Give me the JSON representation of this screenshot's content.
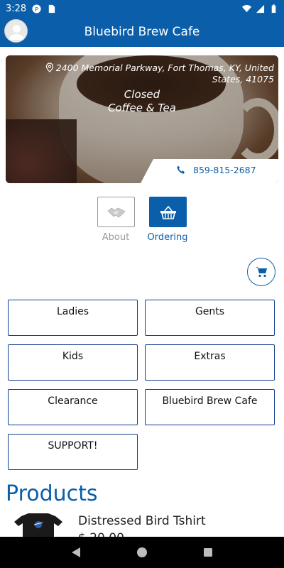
{
  "status_bar": {
    "time": "3:28"
  },
  "app_bar": {
    "title": "Bluebird Brew Cafe"
  },
  "hero": {
    "address": "2400 Memorial Parkway, Fort Thomas, KY, United States, 41075",
    "open_status": "Closed",
    "category": "Coffee & Tea",
    "phone": "859-815-2687"
  },
  "tabs": [
    {
      "label": "About",
      "icon": "handshake-icon"
    },
    {
      "label": "Ordering",
      "icon": "basket-icon"
    }
  ],
  "categories": [
    "Ladies",
    "Gents",
    "Kids",
    "Extras",
    "Clearance",
    "Bluebird Brew Cafe",
    "SUPPORT!"
  ],
  "products": {
    "heading": "Products",
    "items": [
      {
        "name": "Distressed Bird Tshirt",
        "price": "$ 20.00"
      }
    ]
  },
  "colors": {
    "primary": "#0b5faa",
    "border_dark_blue": "#0d3c8c",
    "muted": "#9a9a9a"
  }
}
